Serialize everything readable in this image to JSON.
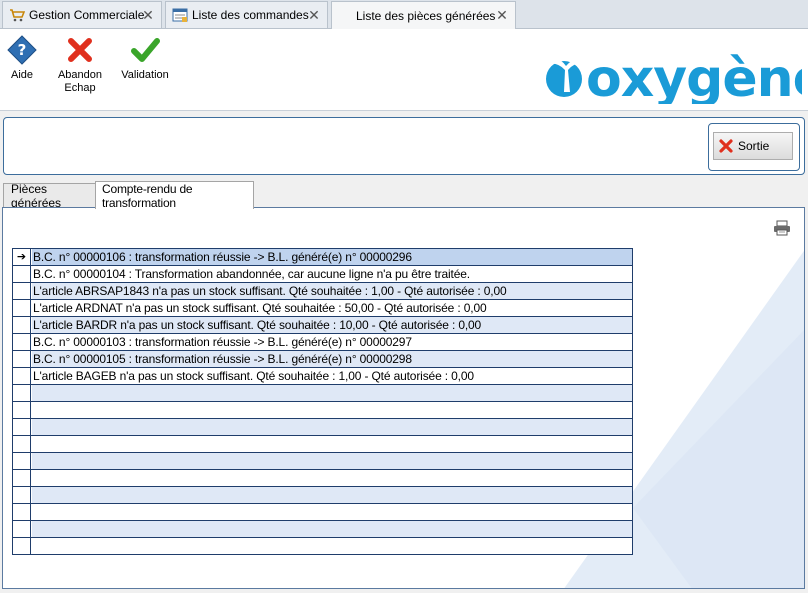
{
  "doc_tabs": [
    {
      "label": "Gestion Commerciale",
      "icon": "shopping-cart-icon"
    },
    {
      "label": "Liste des commandes",
      "icon": "list-window-icon"
    },
    {
      "label": "Liste des pièces générées",
      "icon": ""
    }
  ],
  "toolbar": {
    "help_label": "Aide",
    "abandon_label": "Abandon",
    "abandon_sub": "Echap",
    "validation_label": "Validation"
  },
  "logo_text": "oxygène",
  "sortie_label": "Sortie",
  "inner_tabs": [
    {
      "label": "Pièces générées"
    },
    {
      "label": "Compte-rendu de transformation"
    }
  ],
  "report_rows": [
    "B.C. n° 00000106 : transformation réussie -> B.L. généré(e) n° 00000296",
    "B.C. n° 00000104 : Transformation abandonnée, car aucune ligne n'a pu être traitée.",
    "L'article ABRSAP1843 n'a pas un stock suffisant. Qté souhaitée : 1,00 - Qté autorisée : 0,00",
    "L'article ARDNAT n'a pas un stock suffisant. Qté souhaitée : 50,00 - Qté autorisée : 0,00",
    "L'article BARDR n'a pas un stock suffisant. Qté souhaitée : 10,00 - Qté autorisée : 0,00",
    "B.C. n° 00000103 : transformation réussie -> B.L. généré(e) n° 00000297",
    "B.C. n° 00000105 : transformation réussie -> B.L. généré(e) n° 00000298",
    "L'article BAGEB n'a pas un stock suffisant. Qté souhaitée : 1,00 - Qté autorisée : 0,00"
  ],
  "current_row_marker": "➔",
  "colors": {
    "accent": "#1a9bd7",
    "row_alt": "#dfe8f6",
    "grid_border": "#1f3d6b"
  }
}
